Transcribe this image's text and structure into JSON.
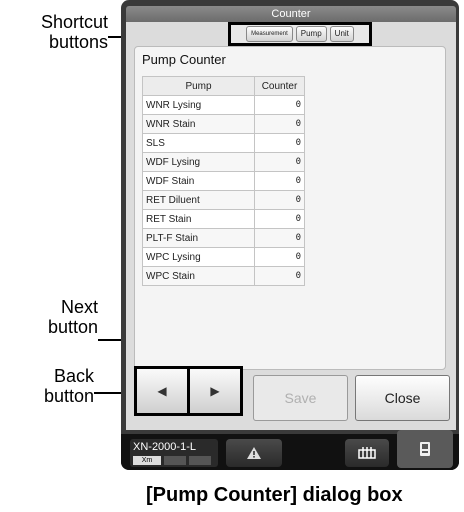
{
  "window": {
    "title": "Counter"
  },
  "shortcuts": [
    {
      "label": "Measurement"
    },
    {
      "label": "Pump"
    },
    {
      "label": "Unit"
    }
  ],
  "panel": {
    "title": "Pump Counter"
  },
  "table": {
    "headers": [
      "Pump",
      "Counter"
    ],
    "rows": [
      {
        "name": "WNR Lysing",
        "counter": "0"
      },
      {
        "name": "WNR Stain",
        "counter": "0"
      },
      {
        "name": "SLS",
        "counter": "0"
      },
      {
        "name": "WDF Lysing",
        "counter": "0"
      },
      {
        "name": "WDF Stain",
        "counter": "0"
      },
      {
        "name": "RET Diluent",
        "counter": "0"
      },
      {
        "name": "RET Stain",
        "counter": "0"
      },
      {
        "name": "PLT-F Stain",
        "counter": "0"
      },
      {
        "name": "WPC Lysing",
        "counter": "0"
      },
      {
        "name": "WPC Stain",
        "counter": "0"
      }
    ]
  },
  "buttons": {
    "back": "◀",
    "next": "▶",
    "save": "Save",
    "close": "Close"
  },
  "status": {
    "model": "XN-2000-1-L",
    "mode": "Xm"
  },
  "callouts": {
    "shortcut": "Shortcut\nbuttons",
    "next": "Next\nbutton",
    "back": "Back\nbutton"
  },
  "caption": "[Pump Counter] dialog box",
  "icons": {
    "warning": "warning-icon",
    "rack": "rack-icon",
    "device": "device-icon"
  }
}
